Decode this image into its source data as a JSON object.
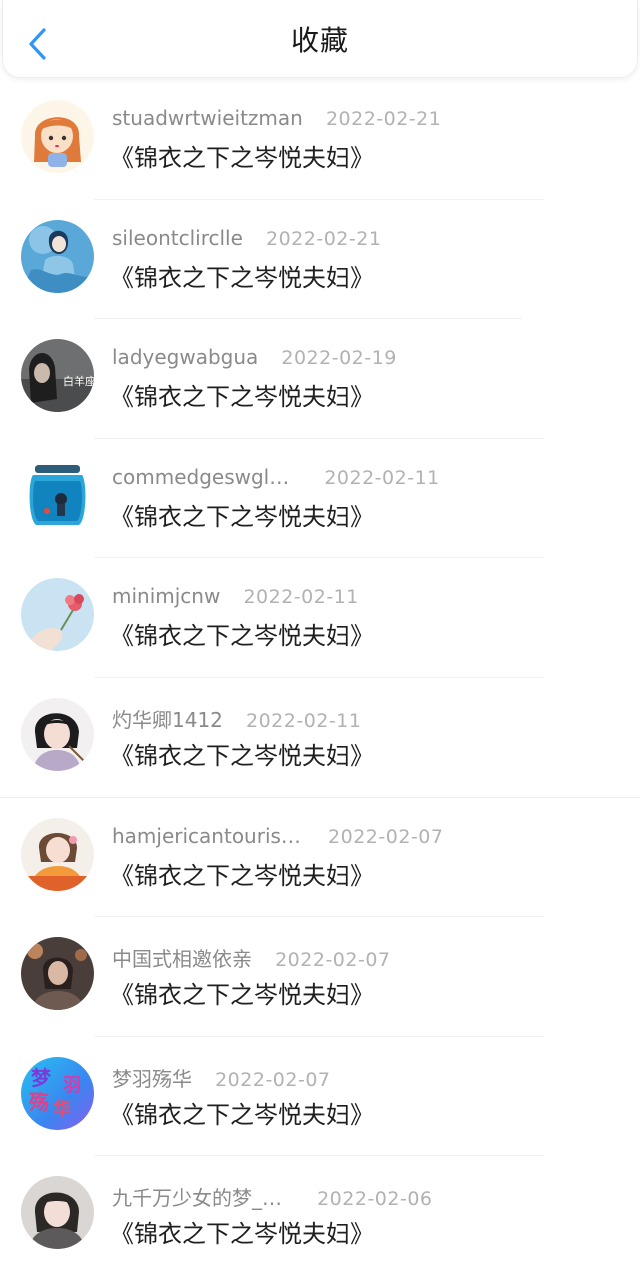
{
  "header": {
    "title": "收藏",
    "back_icon": "chevron-left-icon",
    "accent": "#2f95f6"
  },
  "items": [
    {
      "username": "stuadwrtwieitzman",
      "date": "2022-02-21",
      "title": "《锦衣之下之岑悦夫妇》",
      "avatar": "cartoon-girl"
    },
    {
      "username": "sileontclirclle",
      "date": "2022-02-21",
      "title": "《锦衣之下之岑悦夫妇》",
      "avatar": "blue-illustration"
    },
    {
      "username": "ladyegwabgua",
      "date": "2022-02-19",
      "title": "《锦衣之下之岑悦夫妇》",
      "avatar": "dark-portrait",
      "avatar_text": "白羊座"
    },
    {
      "username": "commedgeswgl…",
      "date": "2022-02-11",
      "title": "《锦衣之下之岑悦夫妇》",
      "avatar": "jar-boy"
    },
    {
      "username": "minimjcnw",
      "date": "2022-02-11",
      "title": "《锦衣之下之岑悦夫妇》",
      "avatar": "hand-flower"
    },
    {
      "username": "灼华卿1412",
      "date": "2022-02-11",
      "title": "《锦衣之下之岑悦夫妇》",
      "avatar": "girl-portrait"
    },
    {
      "username": "hamjericantouris…",
      "date": "2022-02-07",
      "title": "《锦衣之下之岑悦夫妇》",
      "avatar": "girl-orange"
    },
    {
      "username": "中国式相邀依亲",
      "date": "2022-02-07",
      "title": "《锦衣之下之岑悦夫妇》",
      "avatar": "dark-warm"
    },
    {
      "username": "梦羽殇华",
      "date": "2022-02-07",
      "title": "《锦衣之下之岑悦夫妇》",
      "avatar": "text-logo",
      "avatar_text": [
        "梦",
        "羽",
        "殇",
        "华"
      ]
    },
    {
      "username": "九千万少女的梦_…",
      "date": "2022-02-06",
      "title": "《锦衣之下之岑悦夫妇》",
      "avatar": "girl-gray"
    }
  ]
}
